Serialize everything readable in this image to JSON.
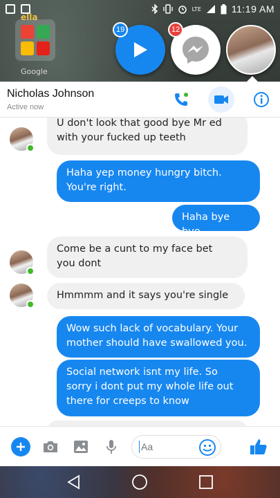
{
  "status_bar": {
    "time": "11:19 AM",
    "network": "LTE",
    "icons": [
      "facebook-notification-icon",
      "image-notification-icon",
      "bluetooth-icon",
      "vibrate-icon",
      "alarm-icon",
      "signal-icon",
      "battery-icon"
    ]
  },
  "home_screen": {
    "folder_label": "Google",
    "top_label": "ella"
  },
  "chat_heads": {
    "video_badge": "19",
    "messenger_badge": "12"
  },
  "header": {
    "name": "Nicholas Johnson",
    "status": "Active now"
  },
  "messages": [
    {
      "from": "them",
      "text_lines": [
        "U don't look that good bye Mr ed",
        "with your fucked up teeth"
      ]
    },
    {
      "from": "me",
      "text_lines": [
        "Haha yep money hungry bitch.",
        "You're right."
      ]
    },
    {
      "from": "me",
      "text_lines": [
        "Haha bye bye"
      ]
    },
    {
      "from": "them",
      "text_lines": [
        "Come be a cunt to my face bet",
        "you dont"
      ]
    },
    {
      "from": "them",
      "text_lines": [
        "Hmmmm and it says you're single"
      ]
    },
    {
      "from": "me",
      "text_lines": [
        "Wow such lack of vocabulary. Your",
        "mother should have swallowed you."
      ]
    },
    {
      "from": "me",
      "text_lines": [
        "Social network isnt my life. So",
        "sorry i dont put my whole life out",
        "there for creeps to know"
      ]
    }
  ],
  "composer": {
    "placeholder": "Aa",
    "value": ""
  },
  "colors": {
    "accent": "#1787f0",
    "incoming_bubble": "#f0f0f0",
    "online": "#42b72a",
    "badge_red": "#e8413c"
  }
}
